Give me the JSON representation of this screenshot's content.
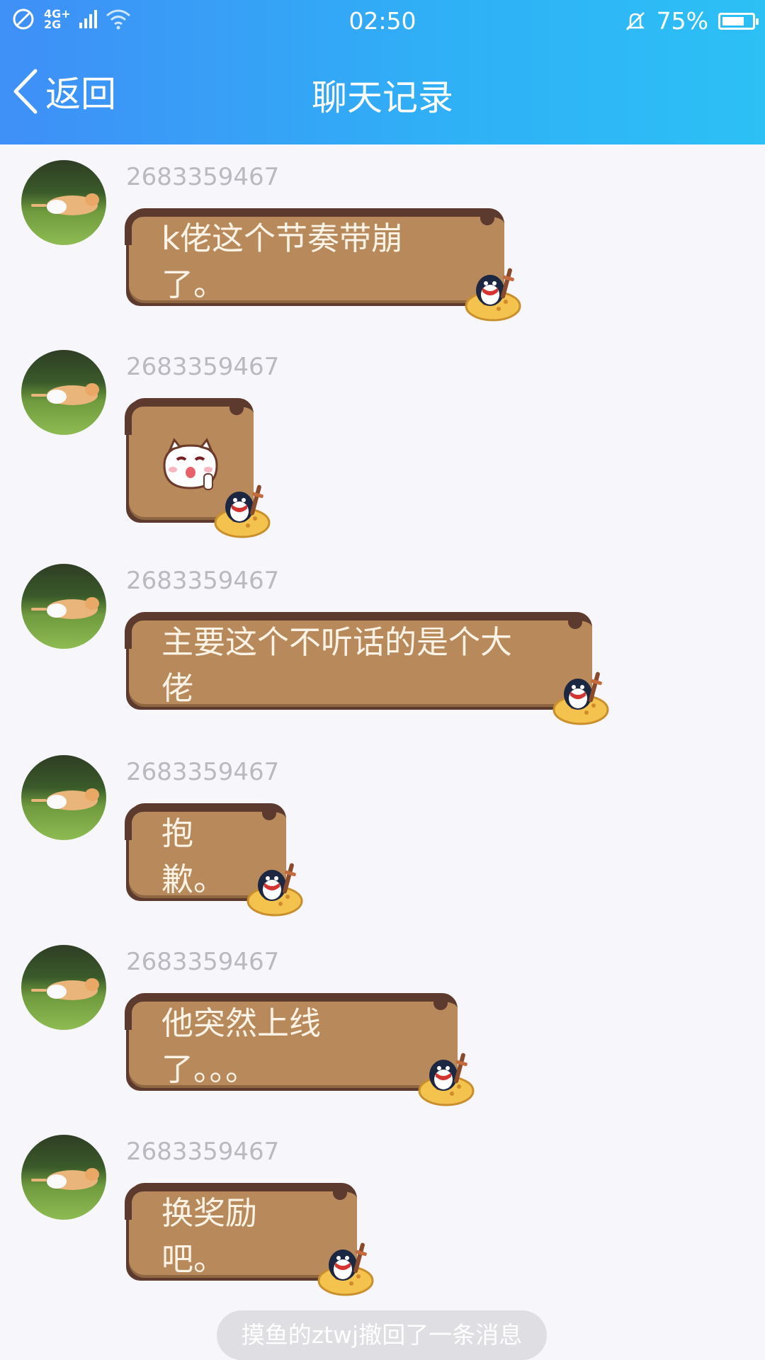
{
  "status_bar": {
    "network_top": "4G+",
    "network_bottom": "2G",
    "time": "02:50",
    "battery": "75%",
    "battery_level": 0.75
  },
  "nav": {
    "back_label": "返回",
    "title": "聊天记录"
  },
  "messages": [
    {
      "sender": "2683359467",
      "text": "k佬这个节奏带崩了。"
    },
    {
      "sender": "2683359467",
      "text": ""
    },
    {
      "sender": "2683359467",
      "text": "主要这个不听话的是个大佬"
    },
    {
      "sender": "2683359467",
      "text": "抱歉。"
    },
    {
      "sender": "2683359467",
      "text": "他突然上线了。。。"
    },
    {
      "sender": "2683359467",
      "text": "换奖励吧。"
    }
  ],
  "toast": "摸鱼的ztwj撤回了一条消息",
  "icons": {
    "no_sim": "no-sim-icon",
    "wifi": "wifi-icon",
    "mute": "bell-off-icon",
    "back": "chevron-left-icon",
    "sticker": "penguin-sticker-icon",
    "emoji": "cat-emoji-icon"
  },
  "colors": {
    "header_start": "#3f8ff7",
    "header_end": "#2cc0f5",
    "bubble": "#b88a5b",
    "bubble_trim": "#5c3a2e",
    "sender_text": "#b9b9c0",
    "background": "#f7f7fb"
  }
}
